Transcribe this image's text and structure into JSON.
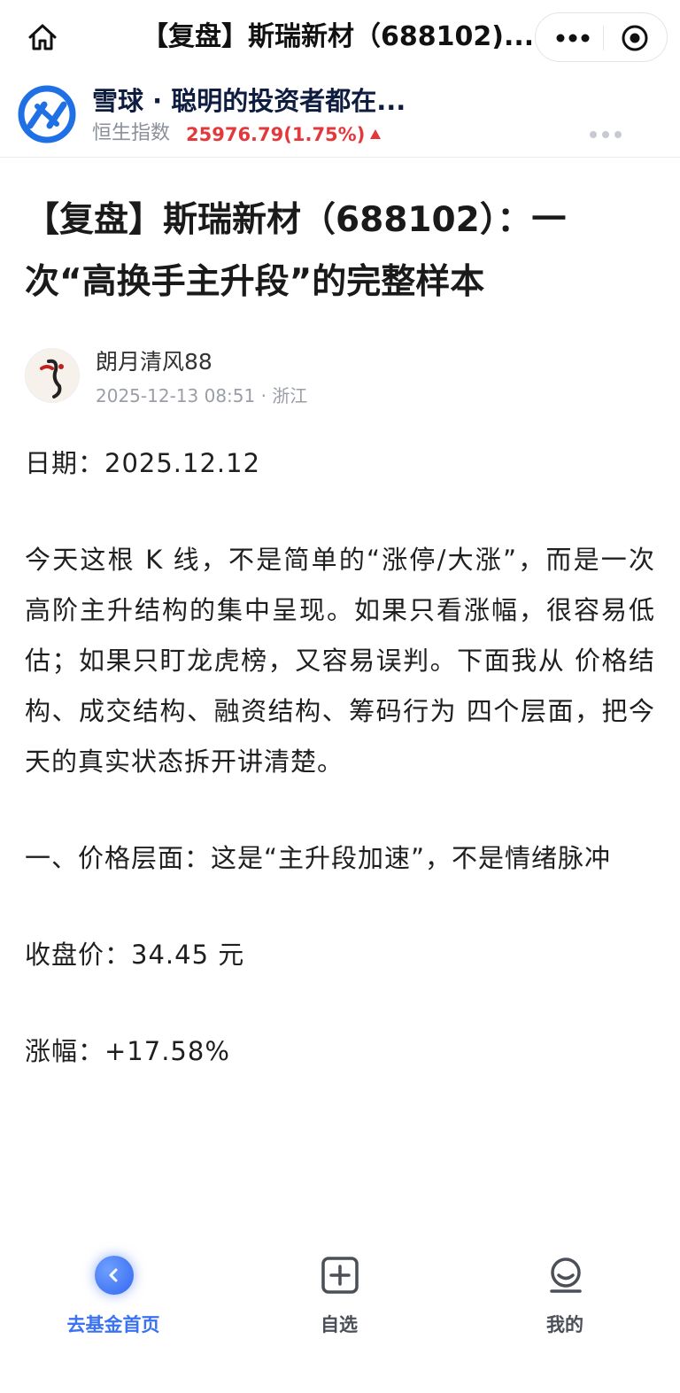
{
  "navbar": {
    "title": "【复盘】斯瑞新材（688102)..."
  },
  "app_header": {
    "app_name": "雪球 · 聪明的投资者都在...",
    "index_label": "恒生指数",
    "index_value": "25976.79(1.75%)",
    "index_color": "#e4393c"
  },
  "article": {
    "title": "【复盘】斯瑞新材（688102）：一次“高换手主升段”的完整样本",
    "author": "朗月清风88",
    "meta": "2025-12-13 08:51 · 浙江",
    "paragraphs": [
      "日期：2025.12.12",
      "今天这根 K 线，不是简单的“涨停/大涨”，而是一次高阶主升结构的集中呈现。如果只看涨幅，很容易低估；如果只盯龙虎榜，又容易误判。下面我从 价格结构、成交结构、融资结构、筹码行为 四个层面，把今天的真实状态拆开讲清楚。",
      "一、价格层面：这是“主升段加速”，不是情绪脉冲",
      "收盘价：34.45 元",
      "涨幅：+17.58%"
    ]
  },
  "tabbar": {
    "home_label": "去基金首页",
    "watchlist_label": "自选",
    "mine_label": "我的",
    "active_color": "#3a72f3"
  }
}
